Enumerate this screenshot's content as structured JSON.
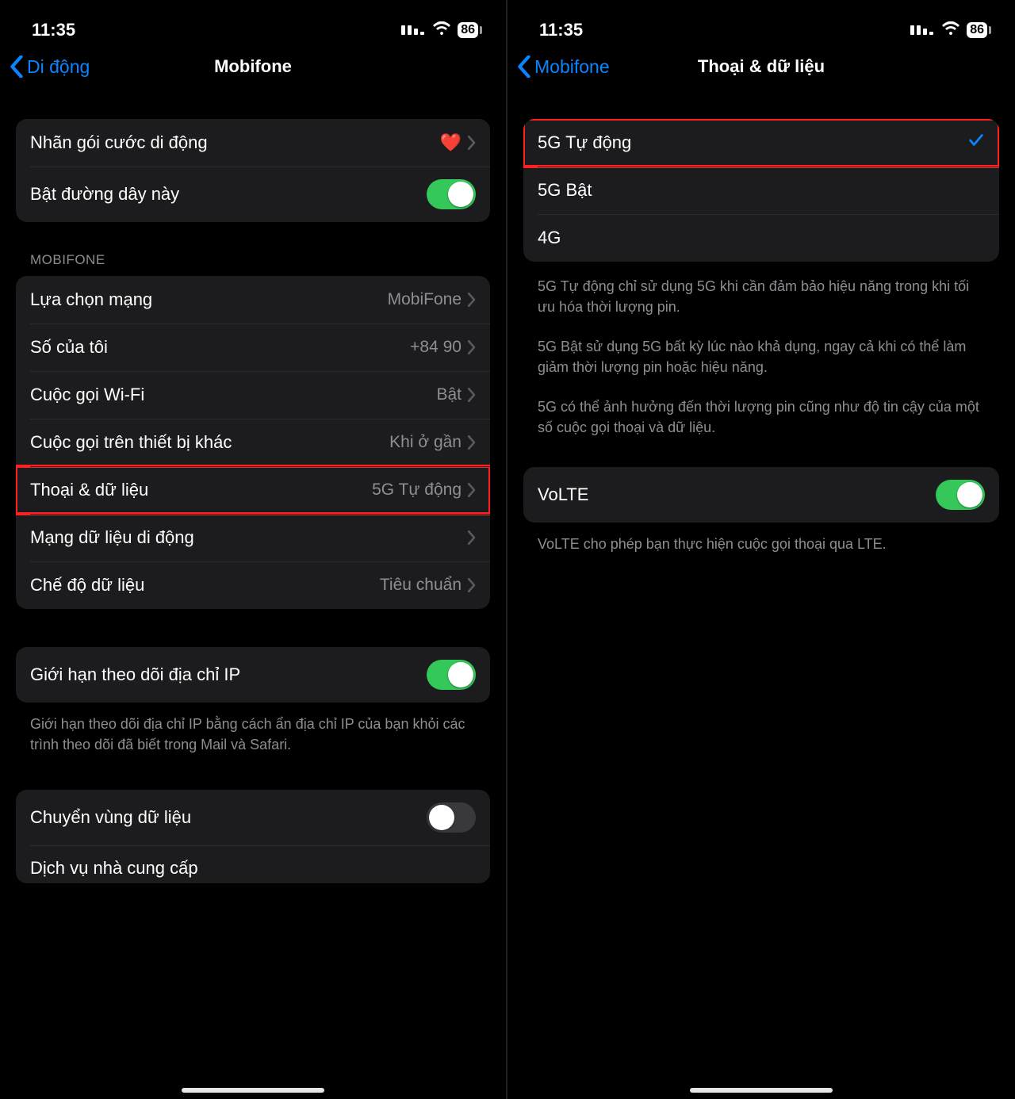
{
  "left": {
    "status": {
      "time": "11:35",
      "battery": "86"
    },
    "back": "Di động",
    "title": "Mobifone",
    "group1": {
      "label_plan": "Nhãn gói cước di động",
      "heart": "❤️",
      "turn_on_line": "Bật đường dây này"
    },
    "section_header": "MOBIFONE",
    "group2": {
      "network": {
        "label": "Lựa chọn mạng",
        "value": "MobiFone"
      },
      "my_number": {
        "label": "Số của tôi",
        "value": "+84 90"
      },
      "wifi_call": {
        "label": "Cuộc gọi Wi-Fi",
        "value": "Bật"
      },
      "other_dev": {
        "label": "Cuộc gọi trên thiết bị khác",
        "value": "Khi ở gần"
      },
      "voice_data": {
        "label": "Thoại & dữ liệu",
        "value": "5G Tự động"
      },
      "data_net": {
        "label": "Mạng dữ liệu di động",
        "value": ""
      },
      "data_mode": {
        "label": "Chế độ dữ liệu",
        "value": "Tiêu chuẩn"
      }
    },
    "group3": {
      "limit_ip": "Giới hạn theo dõi địa chỉ IP"
    },
    "footer_ip": "Giới hạn theo dõi địa chỉ IP bằng cách ẩn địa chỉ IP của bạn khỏi các trình theo dõi đã biết trong Mail và Safari.",
    "group4": {
      "roaming": "Chuyển vùng dữ liệu",
      "carrier": "Dịch vụ nhà cung cấp"
    }
  },
  "right": {
    "status": {
      "time": "11:35",
      "battery": "86"
    },
    "back": "Mobifone",
    "title": "Thoại & dữ liệu",
    "options": {
      "auto": "5G Tự động",
      "on": "5G Bật",
      "g4": "4G"
    },
    "footer1": "5G Tự động chỉ sử dụng 5G khi cần đảm bảo hiệu năng trong khi tối ưu hóa thời lượng pin.",
    "footer2": "5G Bật sử dụng 5G bất kỳ lúc nào khả dụng, ngay cả khi có thể làm giảm thời lượng pin hoặc hiệu năng.",
    "footer3": "5G có thể ảnh hưởng đến thời lượng pin cũng như độ tin cậy của một số cuộc gọi thoại và dữ liệu.",
    "volte": "VoLTE",
    "volte_footer": "VoLTE cho phép bạn thực hiện cuộc gọi thoại qua LTE."
  }
}
